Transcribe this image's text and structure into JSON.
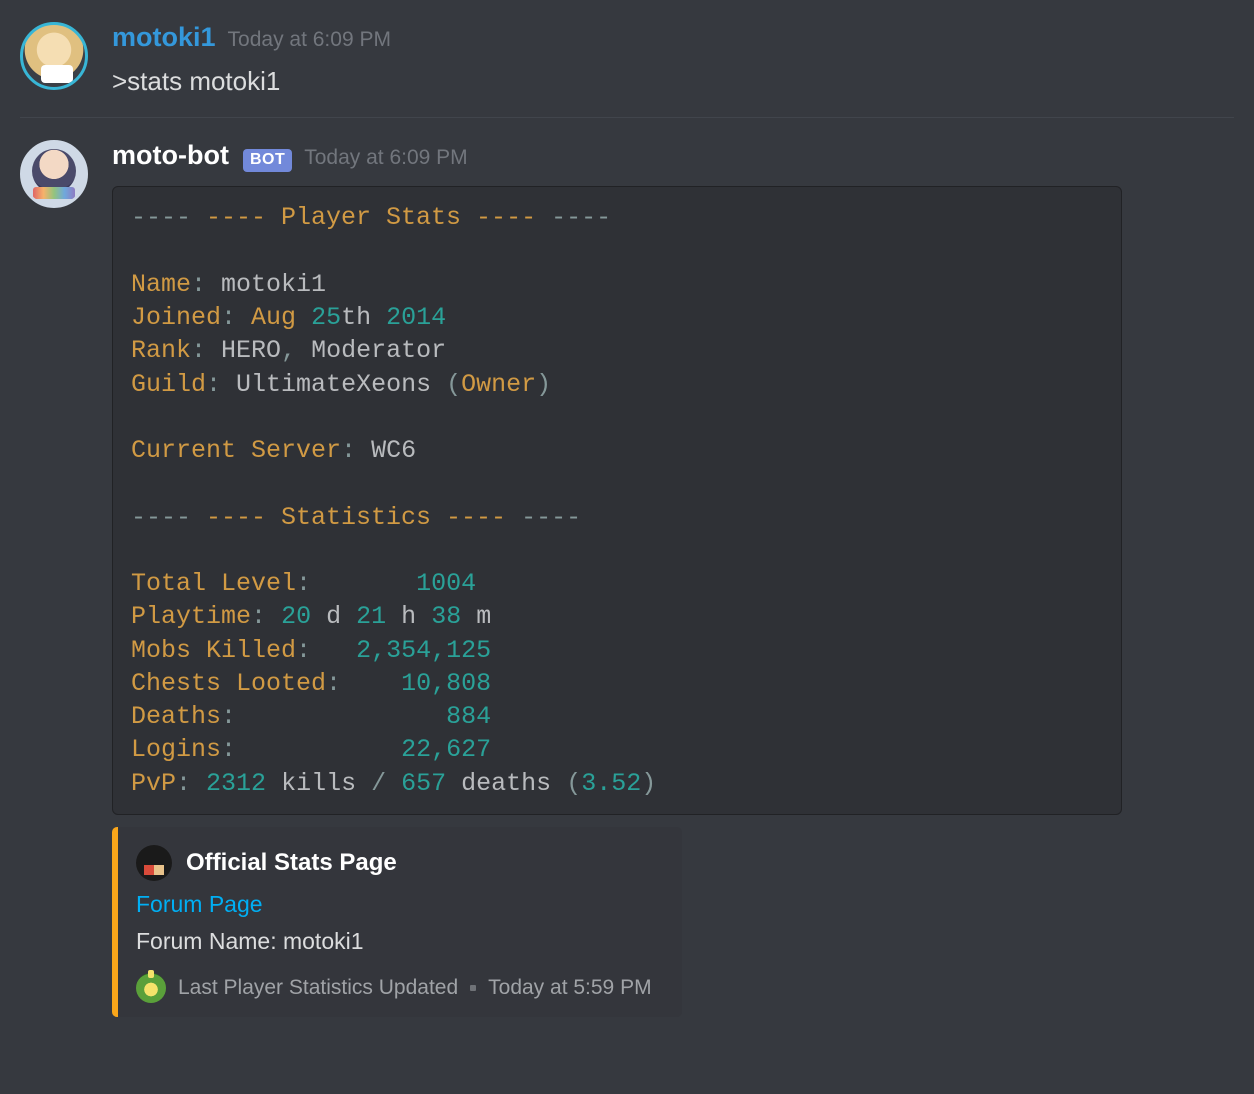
{
  "messages": [
    {
      "author": "motoki1",
      "timestamp": "Today at 6:09 PM",
      "content": ">stats motoki1"
    },
    {
      "author": "moto-bot",
      "is_bot": true,
      "bot_tag": "BOT",
      "timestamp": "Today at 6:09 PM",
      "code": {
        "header1": "---- Player Stats ----",
        "name_label": "Name",
        "name_value": "motoki1",
        "joined_label": "Joined",
        "joined_month": "Aug",
        "joined_day": "25",
        "joined_suffix": "th",
        "joined_year": "2014",
        "rank_label": "Rank",
        "rank_value1": "HERO",
        "rank_sep": ",",
        "rank_value2": "Moderator",
        "guild_label": "Guild",
        "guild_value": "UltimateXeons",
        "guild_role": "Owner",
        "server_label": "Current Server",
        "server_value": "WC6",
        "header2": "---- Statistics ----",
        "total_level_label": "Total Level",
        "total_level_value": "1004",
        "playtime_label": "Playtime",
        "playtime_d": "20",
        "playtime_d_u": "d",
        "playtime_h": "21",
        "playtime_h_u": "h",
        "playtime_m": "38",
        "playtime_m_u": "m",
        "mobs_label": "Mobs Killed",
        "mobs_value": "2,354,125",
        "chests_label": "Chests Looted",
        "chests_value": "10,808",
        "deaths_label": "Deaths",
        "deaths_value": "884",
        "logins_label": "Logins",
        "logins_value": "22,627",
        "pvp_label": "PvP",
        "pvp_kills": "2312",
        "pvp_kills_u": "kills",
        "pvp_sep": "/",
        "pvp_deaths": "657",
        "pvp_deaths_u": "deaths",
        "pvp_ratio": "3.52"
      },
      "embed": {
        "title": "Official Stats Page",
        "link": "Forum Page",
        "desc": "Forum Name: motoki1",
        "footer_text": "Last Player Statistics Updated",
        "footer_time": "Today at 5:59 PM"
      }
    }
  ]
}
